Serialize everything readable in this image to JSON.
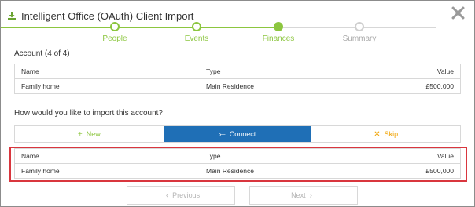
{
  "header": {
    "title": "Intelligent Office (OAuth) Client Import",
    "icon": "download-icon",
    "close_icon": "close-icon"
  },
  "stepper": {
    "steps": [
      {
        "label": "People",
        "state": "done"
      },
      {
        "label": "Events",
        "state": "done"
      },
      {
        "label": "Finances",
        "state": "current"
      },
      {
        "label": "Summary",
        "state": "pending"
      }
    ]
  },
  "account": {
    "heading": "Account (4 of 4)",
    "columns": [
      "Name",
      "Type",
      "Value"
    ],
    "row": [
      "Family home",
      "Main Residence",
      "£500,000"
    ]
  },
  "import": {
    "question": "How would you like to import this account?",
    "options": [
      {
        "label": "New",
        "icon": "plus-icon",
        "glyph": "+"
      },
      {
        "label": "Connect",
        "icon": "connect-icon",
        "glyph": "⤚"
      },
      {
        "label": "Skip",
        "icon": "skip-x-icon",
        "glyph": "✕"
      }
    ],
    "selected": "Connect"
  },
  "match": {
    "columns": [
      "Name",
      "Type",
      "Value"
    ],
    "row": [
      "Family home",
      "Main Residence",
      "£500,000"
    ]
  },
  "nav": {
    "previous": "Previous",
    "next": "Next"
  },
  "colors": {
    "accent_green": "#8cc63f",
    "connect_blue": "#1f6fb6",
    "skip_orange": "#f0a200",
    "highlight_red": "#d9363e"
  }
}
